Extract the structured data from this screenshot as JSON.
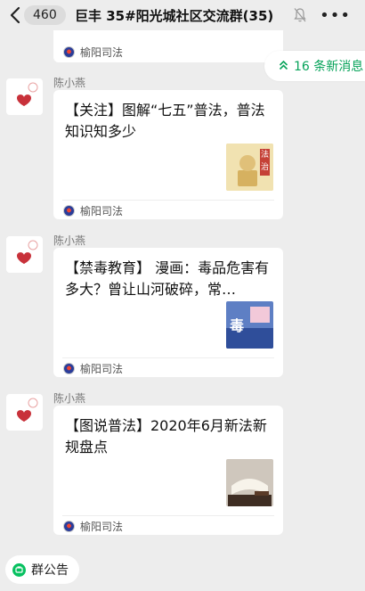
{
  "header": {
    "back_icon": "chevron-left-icon",
    "unread_count": "460",
    "title": "巨丰 35#阳光城社区交流群(35)",
    "mute_icon": "bell-muted-icon",
    "more_icon": "more-dots-icon",
    "more_label": "•••"
  },
  "new_messages": {
    "icon": "double-chevron-up-icon",
    "label": "16 条新消息"
  },
  "messages": [
    {
      "source": "榆阳司法"
    },
    {
      "sender": "陈小燕",
      "text": "【关注】图解“七五”普法，普法知识知多少",
      "source": "榆阳司法",
      "thumb_text": "法治"
    },
    {
      "sender": "陈小燕",
      "text": "【禁毒教育】 漫画：毒品危害有多大？曾让山河破碎，常…",
      "source": "榆阳司法",
      "thumb_text": "毒"
    },
    {
      "sender": "陈小燕",
      "text": "【图说普法】2020年6月新法新规盘点",
      "source": "榆阳司法"
    }
  ],
  "footer": {
    "notice_label": "群公告",
    "notice_icon": "announcement-icon"
  },
  "colors": {
    "background": "#ededed",
    "accent_green": "#07a35a",
    "card": "#ffffff"
  }
}
